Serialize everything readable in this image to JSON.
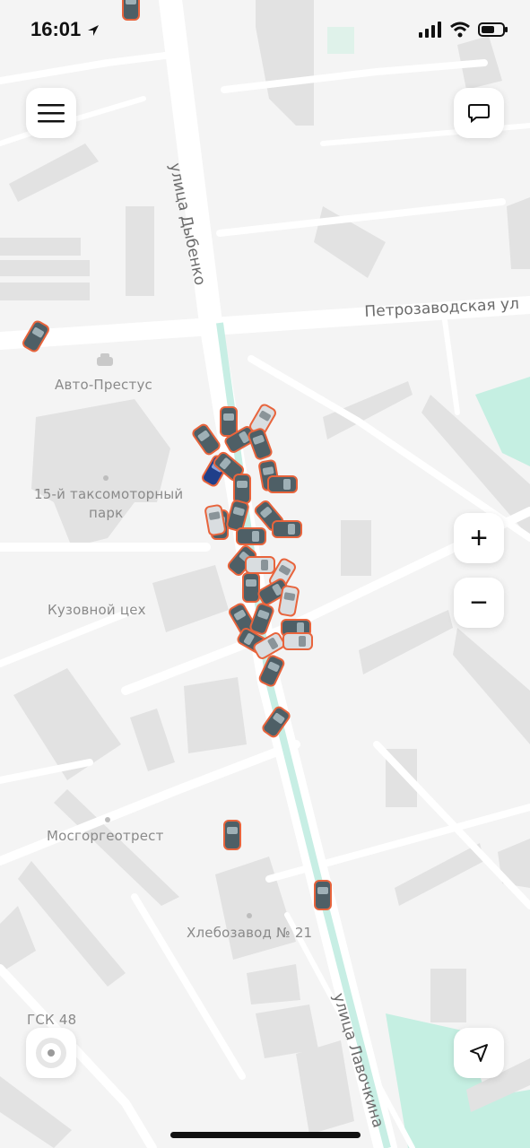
{
  "status_bar": {
    "time": "16:01"
  },
  "map": {
    "streets": [
      {
        "name": "улица Дыбенко"
      },
      {
        "name": "Петрозаводская ул"
      },
      {
        "name": "улица Лавочкина"
      }
    ],
    "places": [
      {
        "name": "Авто-Престус"
      },
      {
        "name": "15-й таксомоторный"
      },
      {
        "name": "парк"
      },
      {
        "name": "Кузовной цех"
      },
      {
        "name": "Мосгоргеотрест"
      },
      {
        "name": "Хлебозавод № 21"
      },
      {
        "name": "ГСК 48"
      }
    ]
  },
  "controls": {
    "menu": "menu-icon",
    "chat": "chat-icon",
    "zoom_in": "+",
    "zoom_out": "−",
    "location": "location-arrow-icon",
    "compass": "target-icon"
  },
  "colors": {
    "map_bg": "#f4f4f4",
    "road": "#ffffff",
    "building": "#e3e3e3",
    "tram": "#c7eee4",
    "park": "#c5efe2",
    "car_body": "#4e5f66",
    "car_trim": "#e8643c"
  }
}
